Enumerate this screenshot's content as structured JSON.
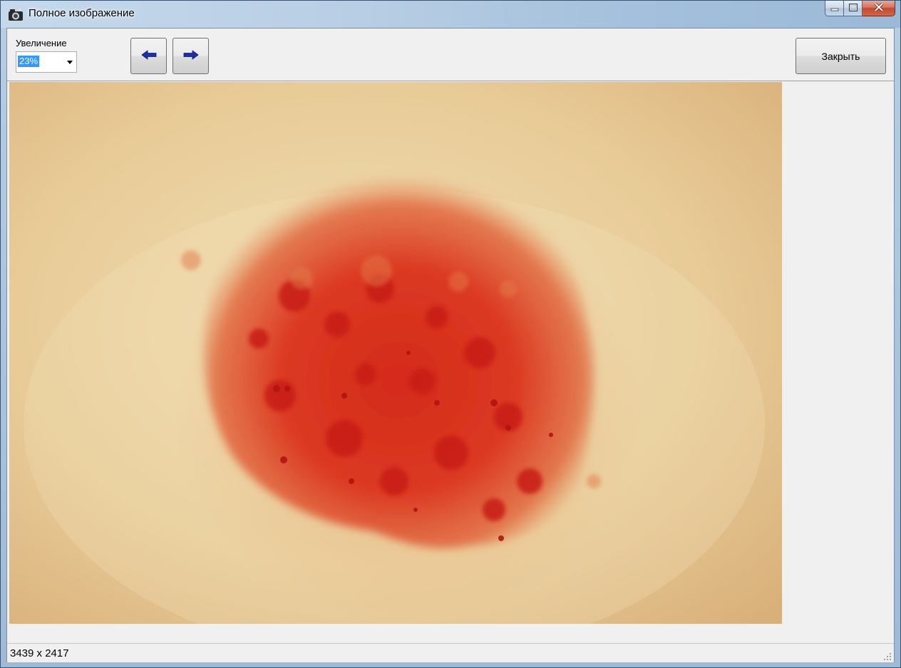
{
  "window": {
    "title": "Полное изображение",
    "title_icon": "camera-icon"
  },
  "caption": {
    "minimize_icon": "minimize-icon",
    "maximize_icon": "maximize-icon",
    "close_icon": "close-icon"
  },
  "toolbar": {
    "zoom_label": "Увеличение",
    "zoom_value": "23%",
    "prev_icon": "arrow-left-icon",
    "next_icon": "arrow-right-icon",
    "close_label": "Закрыть"
  },
  "status": {
    "dimensions": "3439 x 2417"
  },
  "colors": {
    "selection": "#3399ff",
    "arrow": "#1a2fa8",
    "skin": "#e9cf9d",
    "lesion": "#d9321f"
  }
}
